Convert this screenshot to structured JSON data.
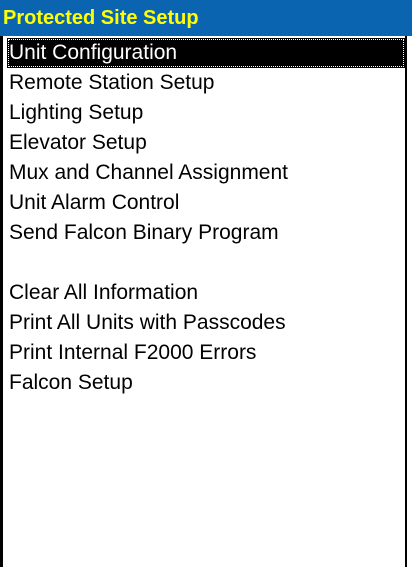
{
  "window": {
    "title": "Protected Site Setup"
  },
  "menu": {
    "selected_index": 0,
    "items": [
      {
        "label": "Unit Configuration"
      },
      {
        "label": "Remote Station Setup"
      },
      {
        "label": "Lighting Setup"
      },
      {
        "label": "Elevator Setup"
      },
      {
        "label": "Mux and Channel Assignment"
      },
      {
        "label": "Unit Alarm Control"
      },
      {
        "label": "Send Falcon Binary Program"
      },
      {
        "label": "Clear All Information"
      },
      {
        "label": "Print All Units with Passcodes"
      },
      {
        "label": "Print Internal F2000 Errors"
      },
      {
        "label": "Falcon Setup"
      }
    ]
  },
  "colors": {
    "title_background": "#0a64b0",
    "title_text": "#ffff00",
    "selection_background": "#000000",
    "selection_text": "#ffffff"
  }
}
